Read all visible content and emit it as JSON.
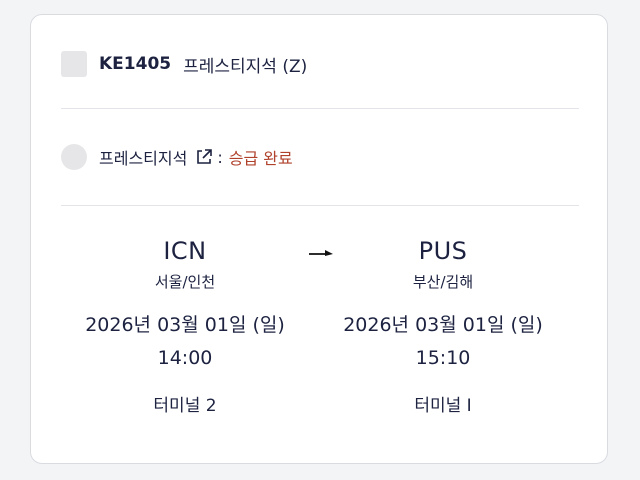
{
  "flight": {
    "number": "KE1405",
    "cabin": "프레스티지석 (Z)"
  },
  "upgrade": {
    "cabin_label": "프레스티지석",
    "separator": ":",
    "status": "승급 완료",
    "status_color": "#b0412b"
  },
  "departure": {
    "code": "ICN",
    "city": "서울/인천",
    "date": "2026년 03월 01일 (일)",
    "time": "14:00",
    "terminal": "터미널 2"
  },
  "arrival": {
    "code": "PUS",
    "city": "부산/김해",
    "date": "2026년 03월 01일 (일)",
    "time": "15:10",
    "terminal": "터미널 I"
  },
  "icons": {
    "external": "external-link-icon",
    "arrow": "arrow-right-icon"
  }
}
